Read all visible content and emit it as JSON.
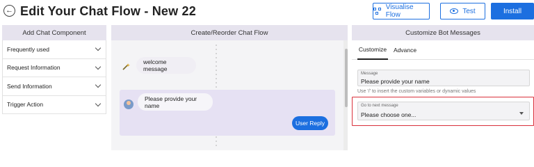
{
  "header": {
    "title": "Edit Your Chat Flow - New 22",
    "visualise_label": "Visualise Flow",
    "test_label": "Test",
    "install_label": "Install"
  },
  "left_panel": {
    "title": "Add Chat Component",
    "items": [
      {
        "label": "Frequently used"
      },
      {
        "label": "Request Information"
      },
      {
        "label": "Send Information"
      },
      {
        "label": "Trigger Action"
      }
    ]
  },
  "middle_panel": {
    "title": "Create/Reorder Chat Flow",
    "welcome_text": "welcome message",
    "question_text": "Please provide your name",
    "reply_label": "User Reply"
  },
  "right_panel": {
    "title": "Customize Bot Messages",
    "tabs": [
      {
        "label": "Customize",
        "active": true
      },
      {
        "label": "Advance",
        "active": false
      }
    ],
    "message_field": {
      "label": "Message",
      "value": "Please provide your name"
    },
    "hint": "Use '/' to insert the custom variables or dynamic values",
    "next_field": {
      "label": "Go to next message",
      "value": "Please choose one..."
    }
  },
  "colors": {
    "accent": "#1c6fe0",
    "panel_header": "#e6e3ee",
    "card": "#e6e1f3",
    "highlight": "#d9303a"
  },
  "icons": [
    "back-arrow-icon",
    "flow-icon",
    "eye-icon",
    "chevron-down-icon",
    "wand-icon",
    "user-avatar-icon",
    "dropdown-caret-icon"
  ]
}
